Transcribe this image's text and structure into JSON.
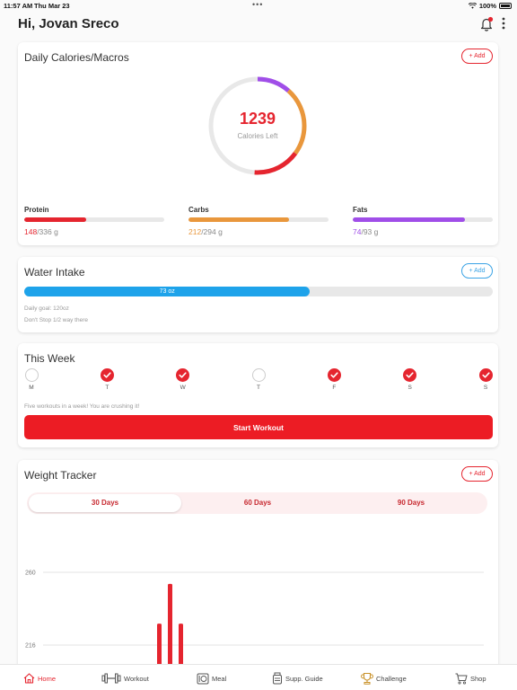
{
  "status_bar": {
    "time": "11:57 AM",
    "date": "Thu Mar 23",
    "battery": "100%"
  },
  "header": {
    "greeting": "Hi, Jovan Sreco"
  },
  "macros_card": {
    "title": "Daily Calories/Macros",
    "add_label": "+ Add",
    "calories_left": "1239",
    "calories_label": "Calories Left",
    "ring_colors": {
      "track": "#e8e8e8",
      "protein": "#e5252f",
      "carbs": "#e9973c",
      "fats": "#a04ee8"
    },
    "items": [
      {
        "name": "Protein",
        "current": "148",
        "rest": "/336 g",
        "fraction": 0.44,
        "color": "#e5252f"
      },
      {
        "name": "Carbs",
        "current": "212",
        "rest": "/294 g",
        "fraction": 0.72,
        "color": "#e9973c"
      },
      {
        "name": "Fats",
        "current": "74",
        "rest": "/93 g",
        "fraction": 0.8,
        "color": "#a04ee8"
      }
    ]
  },
  "water_card": {
    "title": "Water Intake",
    "add_label": "+ Add",
    "amount": "73 oz",
    "fraction": 0.61,
    "goal_text": "Daily goal: 120oz",
    "encourage_text": "Don't Stop 1/2 way there"
  },
  "week_card": {
    "title": "This Week",
    "days": [
      {
        "label": "M",
        "done": false
      },
      {
        "label": "T",
        "done": true
      },
      {
        "label": "W",
        "done": true
      },
      {
        "label": "T",
        "done": false
      },
      {
        "label": "F",
        "done": true
      },
      {
        "label": "S",
        "done": true
      },
      {
        "label": "S",
        "done": true
      }
    ],
    "message": "Five workouts in a week! You are crushing it!",
    "start_label": "Start Workout"
  },
  "weight_card": {
    "title": "Weight Tracker",
    "add_label": "+ Add",
    "tabs": [
      "30 Days",
      "60 Days",
      "90 Days"
    ],
    "active_tab": "30 Days"
  },
  "chart_data": {
    "type": "bar",
    "y_ticks": [
      260,
      216
    ],
    "values": [
      229,
      253,
      229
    ],
    "bar_color": "#e5252f",
    "grid": true
  },
  "bottom_nav": {
    "items": [
      {
        "label": "Home",
        "icon": "home-icon",
        "active": true
      },
      {
        "label": "Workout",
        "icon": "dumbbell-icon",
        "active": false
      },
      {
        "label": "Meal",
        "icon": "meal-icon",
        "active": false
      },
      {
        "label": "Supp. Guide",
        "icon": "supplement-jar-icon",
        "active": false
      },
      {
        "label": "Challenge",
        "icon": "trophy-icon",
        "active": false
      },
      {
        "label": "Shop",
        "icon": "cart-icon",
        "active": false
      }
    ],
    "accent": "#e5252f"
  }
}
